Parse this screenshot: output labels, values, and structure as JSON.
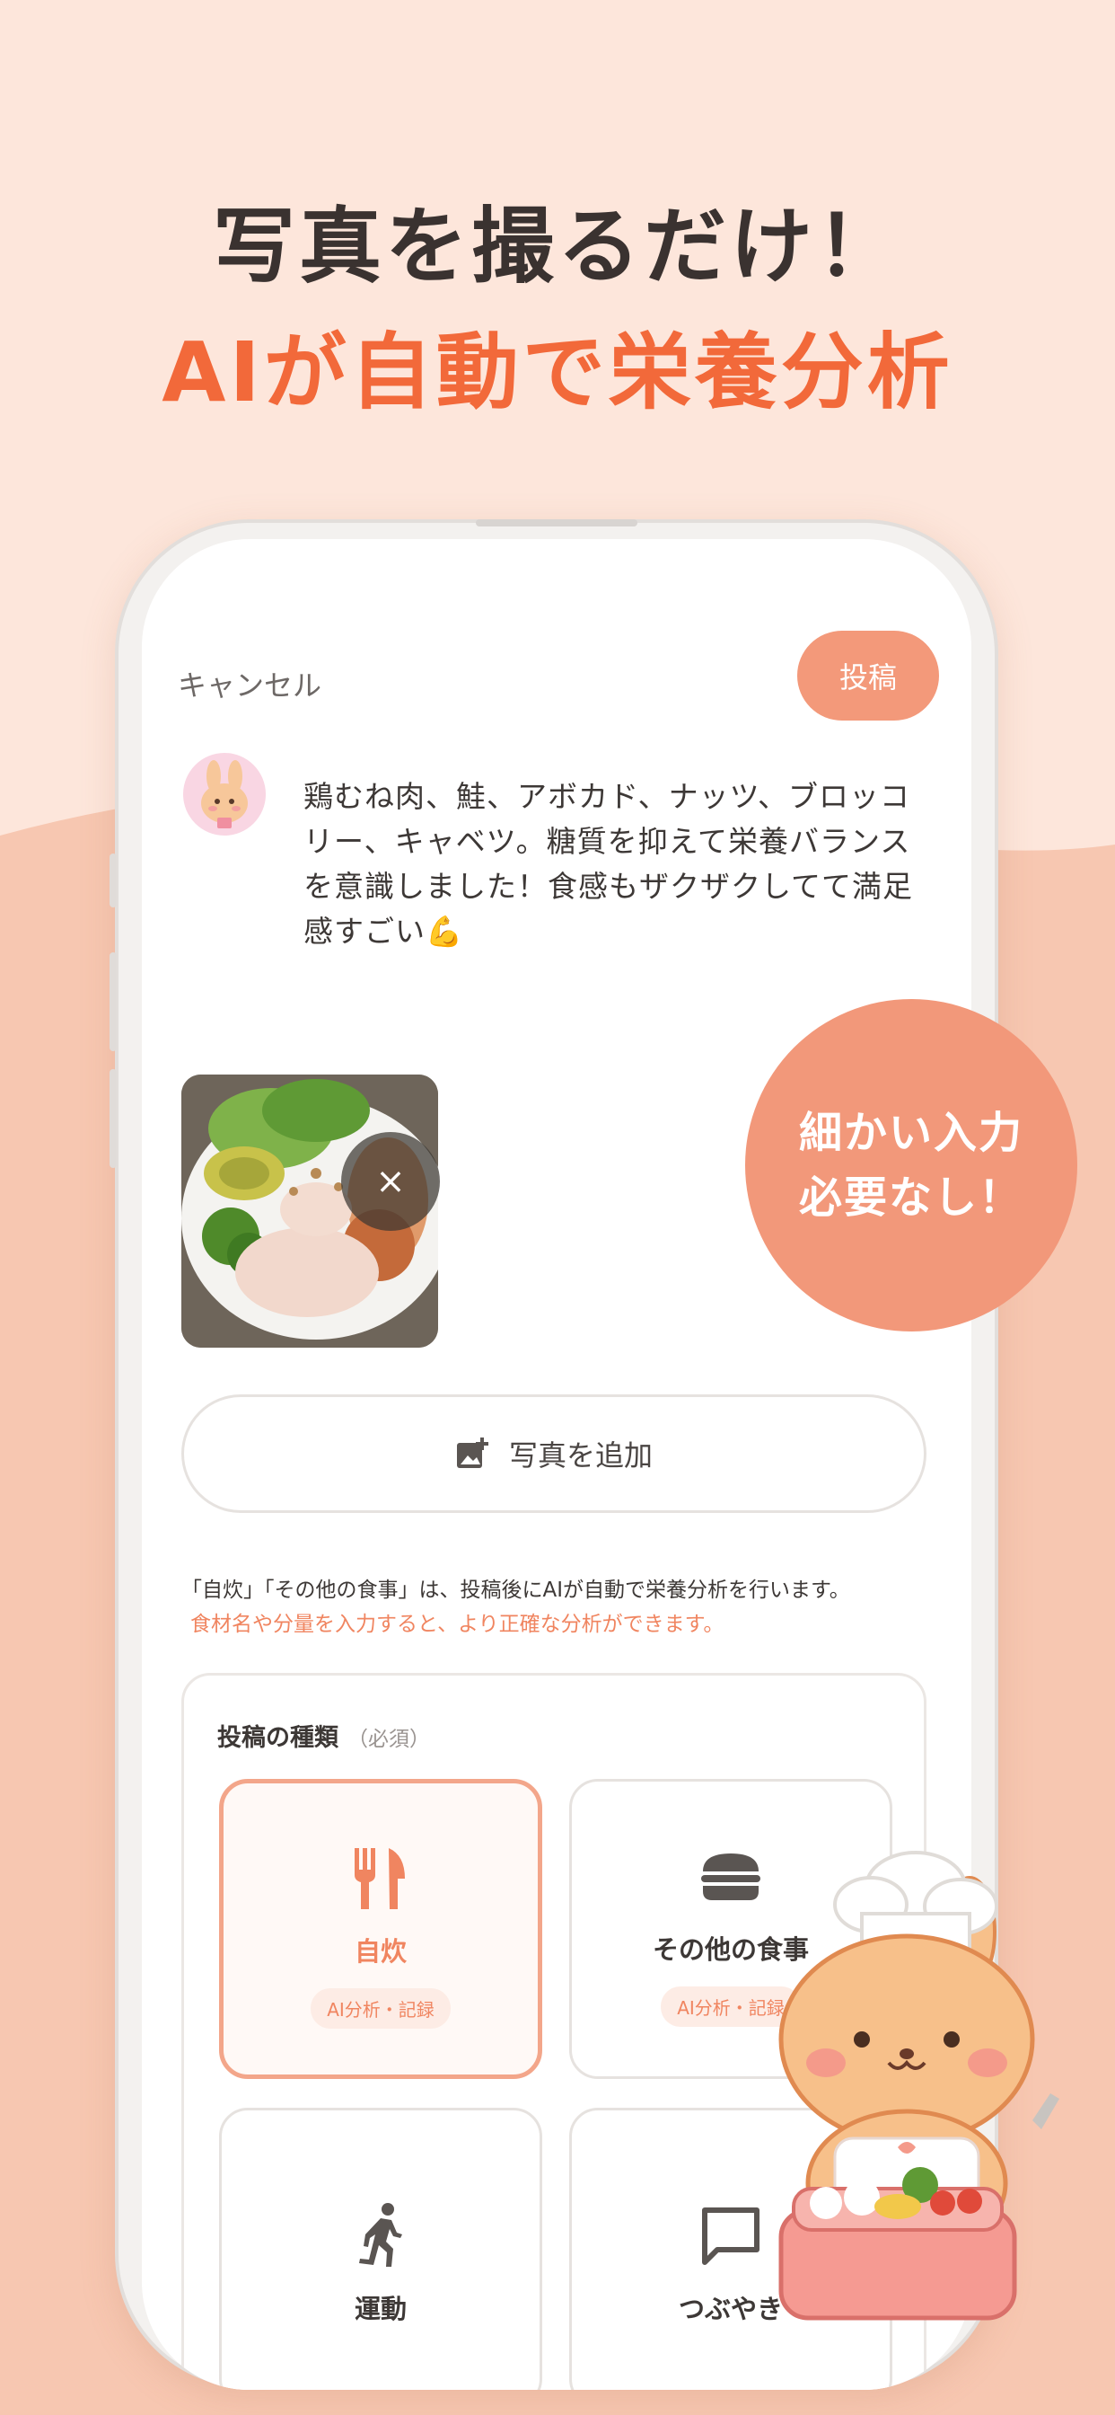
{
  "headline": {
    "line1": "写真を撮るだけ！",
    "line2": "AIが自動で栄養分析"
  },
  "screen": {
    "cancel_label": "キャンセル",
    "post_label": "投稿",
    "post_text": "鶏むね肉、鮭、アボカド、ナッツ、ブロッコリー、キャベツ。糖質を抑えて栄養バランスを意識しました！食感もザクザクしてて満足感すごい💪",
    "remove_photo_label": "×",
    "add_photo_label": "写真を追加",
    "note_line1": "「自炊」「その他の食事」は、投稿後にAIが自動で栄養分析を行います。",
    "note_line2": "食材名や分量を入力すると、より正確な分析ができます。",
    "type_section": {
      "label": "投稿の種類",
      "required": "（必須）",
      "options": [
        {
          "label": "自炊",
          "tag": "AI分析・記録",
          "icon": "fork-knife-icon",
          "selected": true
        },
        {
          "label": "その他の食事",
          "tag": "AI分析・記録",
          "icon": "burger-icon",
          "selected": false
        },
        {
          "label": "運動",
          "tag": "",
          "icon": "running-icon",
          "selected": false
        },
        {
          "label": "つぶやき",
          "tag": "",
          "icon": "speech-bubble-icon",
          "selected": false
        }
      ]
    }
  },
  "badge": {
    "line1": "細かい入力",
    "line2": "必要なし！"
  },
  "colors": {
    "accent": "#f2693a",
    "post_button": "#f3997a",
    "badge": "#f2987a",
    "background_top": "#fde6db",
    "background_bottom": "#f7c7b1"
  }
}
